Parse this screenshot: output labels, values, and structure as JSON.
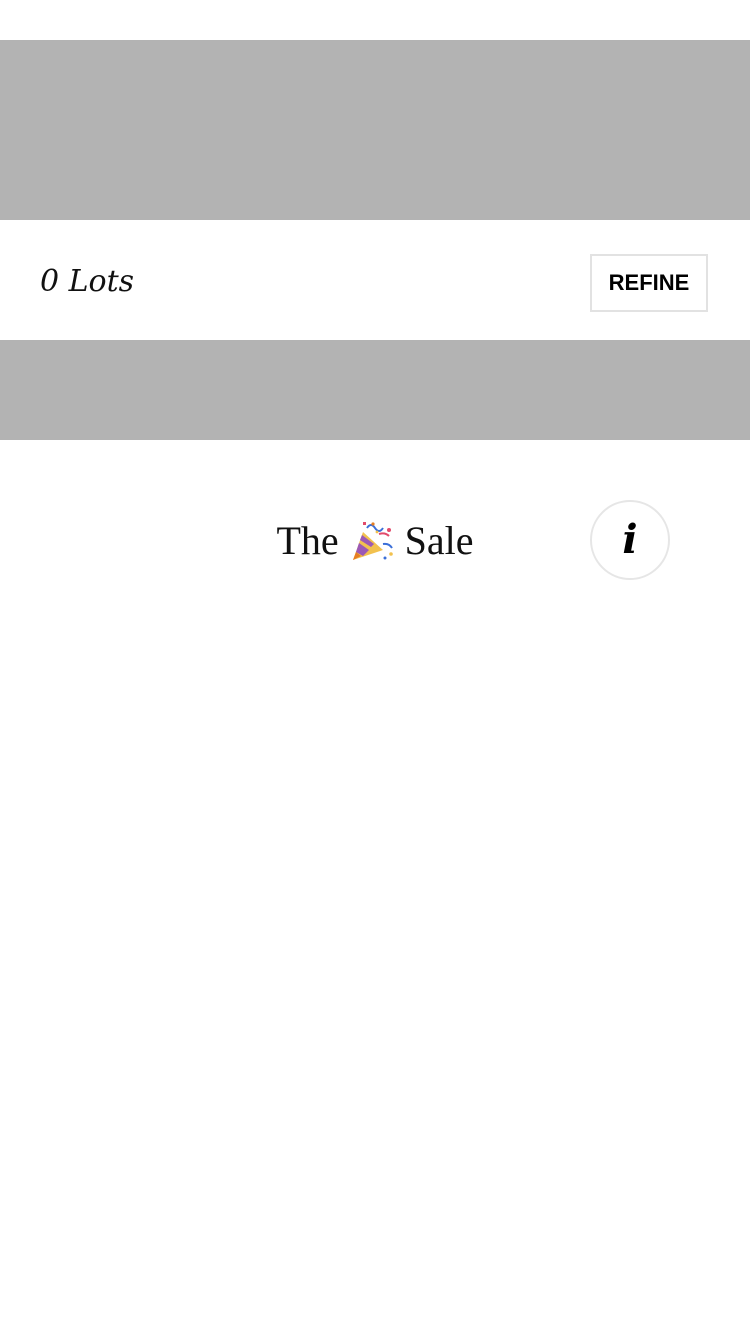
{
  "toolbar": {
    "lot_count": "0 Lots",
    "refine_label": "REFINE"
  },
  "sale": {
    "title_prefix": "The",
    "title_icon": "party-popper-icon",
    "title_suffix": "Sale",
    "info_icon": "i"
  },
  "colors": {
    "placeholder_gray": "#b3b3b3",
    "border_light": "#e2e2e2",
    "text": "#111111"
  }
}
